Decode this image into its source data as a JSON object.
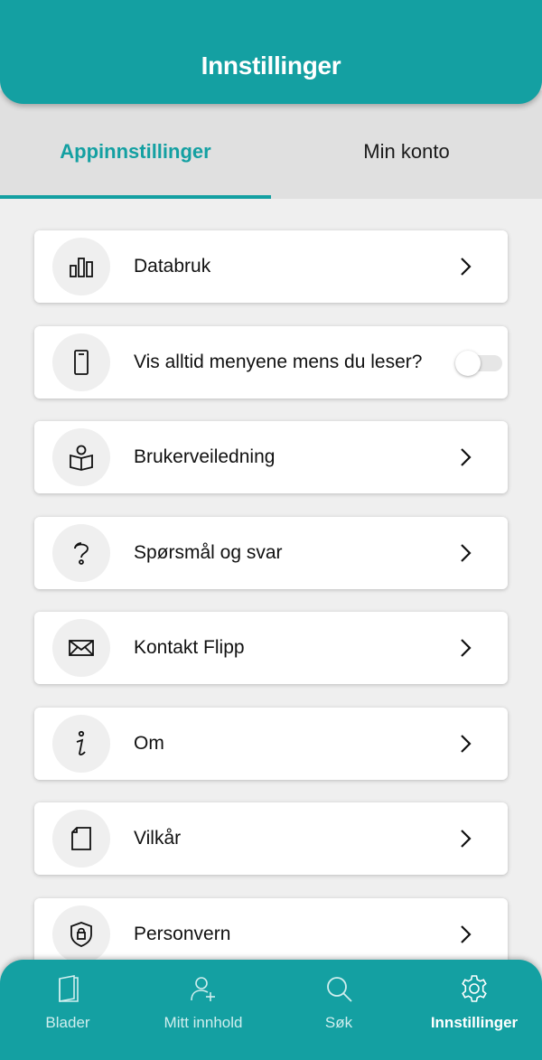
{
  "header": {
    "title": "Innstillinger"
  },
  "tabs": [
    {
      "label": "Appinnstillinger",
      "active": true
    },
    {
      "label": "Min konto",
      "active": false
    }
  ],
  "settings": {
    "items": [
      {
        "label": "Databruk",
        "icon": "bar-chart-icon",
        "control": "chevron"
      },
      {
        "label": "Vis alltid menyene mens du leser?",
        "icon": "phone-icon",
        "control": "toggle",
        "toggle_on": false
      },
      {
        "label": "Brukerveiledning",
        "icon": "reading-guide-icon",
        "control": "chevron"
      },
      {
        "label": "Spørsmål og svar",
        "icon": "question-icon",
        "control": "chevron"
      },
      {
        "label": "Kontakt Flipp",
        "icon": "envelope-icon",
        "control": "chevron"
      },
      {
        "label": "Om",
        "icon": "info-icon",
        "control": "chevron"
      },
      {
        "label": "Vilkår",
        "icon": "document-icon",
        "control": "chevron"
      },
      {
        "label": "Personvern",
        "icon": "shield-lock-icon",
        "control": "chevron"
      }
    ]
  },
  "bottom_nav": {
    "items": [
      {
        "label": "Blader",
        "icon": "magazine-icon",
        "active": false
      },
      {
        "label": "Mitt innhold",
        "icon": "add-user-icon",
        "active": false
      },
      {
        "label": "Søk",
        "icon": "search-icon",
        "active": false
      },
      {
        "label": "Innstillinger",
        "icon": "gear-icon",
        "active": true
      }
    ]
  },
  "colors": {
    "accent": "#14a0a2",
    "background": "#efefef",
    "tab_bar": "#e0e0e0"
  }
}
